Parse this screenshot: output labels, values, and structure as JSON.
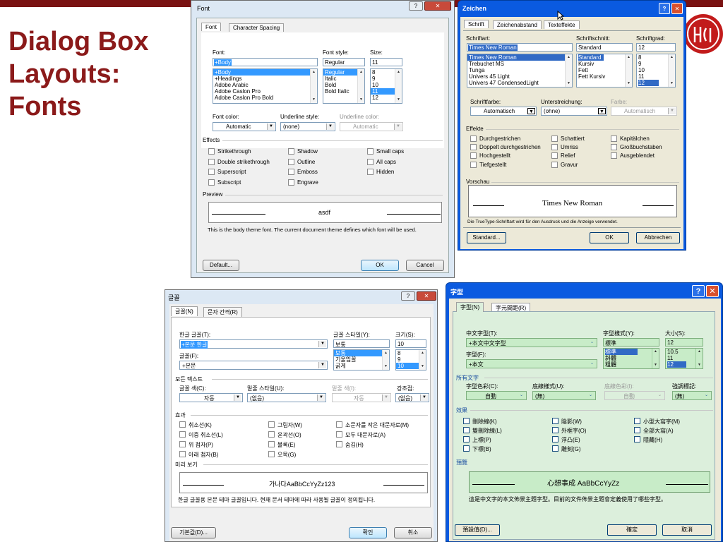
{
  "slide": {
    "title_line1": "Dialog Box",
    "title_line2": "Layouts:",
    "title_line3": "Fonts",
    "accent_color": "#8b1a1a",
    "logo_icon": "hci-logo"
  },
  "font_dialog": {
    "title": "Font",
    "help_glyph": "?",
    "close_glyph": "✕",
    "tabs": [
      "Font",
      "Character Spacing"
    ],
    "font_label": "Font:",
    "font_value": "+Body",
    "font_items": [
      "+Body",
      "+Headings",
      "Adobe Arabic",
      "Adobe Caslon Pro",
      "Adobe Caslon Pro Bold"
    ],
    "style_label": "Font style:",
    "style_value": "Regular",
    "style_items": [
      "Regular",
      "Italic",
      "Bold",
      "Bold Italic"
    ],
    "size_label": "Size:",
    "size_value": "11",
    "size_items": [
      "8",
      "9",
      "10",
      "11",
      "12"
    ],
    "color_label": "Font color:",
    "color_value": "Automatic",
    "underline_style_label": "Underline style:",
    "underline_style_value": "(none)",
    "underline_color_label": "Underline color:",
    "underline_color_value": "Automatic",
    "effects_label": "Effects",
    "effects": [
      "Strikethrough",
      "Double strikethrough",
      "Superscript",
      "Subscript",
      "Shadow",
      "Outline",
      "Emboss",
      "Engrave",
      "Small caps",
      "All caps",
      "Hidden"
    ],
    "preview_label": "Preview",
    "preview_text": "asdf",
    "description": "This is the body theme font. The current document theme defines which font will be used.",
    "default_button": "Default...",
    "ok_button": "OK",
    "cancel_button": "Cancel"
  },
  "zeichen_dialog": {
    "title": "Zeichen",
    "help_glyph": "?",
    "close_glyph": "✕",
    "tabs": [
      "Schrift",
      "Zeichenabstand",
      "Texteffekte"
    ],
    "font_label": "Schriftart:",
    "font_value": "Times New Roman",
    "font_items": [
      "Times New Roman",
      "Trebuchet MS",
      "Tunga",
      "Univers 45 Light",
      "Univers 47 CondensedLight"
    ],
    "style_label": "Schriftschnitt:",
    "style_value": "Standard",
    "style_items": [
      "Standard",
      "Kursiv",
      "Fett",
      "Fett Kursiv"
    ],
    "size_label": "Schriftgrad:",
    "size_value": "12",
    "size_items": [
      "8",
      "9",
      "10",
      "11",
      "12"
    ],
    "color_label": "Schriftfarbe:",
    "color_value": "Automatisch",
    "underline_label": "Unterstreichung:",
    "underline_value": "(ohne)",
    "underline_color_label": "Farbe:",
    "underline_color_value": "Automatisch",
    "effects_label": "Effekte",
    "effects": [
      "Durchgestrichen",
      "Doppelt durchgestrichen",
      "Hochgestellt",
      "Tiefgestellt",
      "Schattiert",
      "Umriss",
      "Relief",
      "Gravur",
      "Kapitälchen",
      "Großbuchstaben",
      "Ausgeblendet"
    ],
    "preview_label": "Vorschau",
    "preview_text": "Times New Roman",
    "description": "Die TrueType-Schriftart wird für den Ausdruck und die Anzeige verwendet.",
    "default_button": "Standard...",
    "ok_button": "OK",
    "cancel_button": "Abbrechen"
  },
  "korean_dialog": {
    "title": "글꼴",
    "help_glyph": "?",
    "close_glyph": "✕",
    "tabs": [
      "글꼴(N)",
      "문자 간격(R)"
    ],
    "hangul_font_label": "한글 글꼴(T):",
    "hangul_font_value": "+본문 한글",
    "font_label": "글꼴(F):",
    "font_value": "+본문",
    "style_label": "글꼴 스타일(Y):",
    "style_value": "보통",
    "style_items": [
      "보통",
      "기울임꼴",
      "굵게"
    ],
    "size_label": "크기(S):",
    "size_value": "10",
    "size_items": [
      "8",
      "9",
      "10"
    ],
    "all_text_label": "모든 텍스트",
    "color_label": "글꼴 색(C):",
    "color_value": "자동",
    "underline_style_label": "밑줄 스타일(U):",
    "underline_style_value": "(없음)",
    "underline_color_label": "밑줄 색(I):",
    "underline_color_value": "자동",
    "emphasis_label": "강조점:",
    "emphasis_value": "(없음)",
    "effects_label": "효과",
    "effects": [
      "취소선(K)",
      "이중 취소선(L)",
      "위 첨자(P)",
      "아래 첨자(B)",
      "그림자(W)",
      "윤곽선(O)",
      "볼록(E)",
      "오목(G)",
      "소문자를 작은 대문자로(M)",
      "모두 대문자로(A)",
      "숨김(H)"
    ],
    "preview_label": "미리 보기",
    "preview_text": "가나다AaBbCcYyZz123",
    "description": "한글 글꼴용 본문 테마 글꼴입니다. 현재 문서 테마에 따라 사용될 글꼴이 정의됩니다.",
    "default_button": "기본값(D)...",
    "ok_button": "확인",
    "cancel_button": "취소"
  },
  "chinese_dialog": {
    "title": "字型",
    "help_glyph": "?",
    "close_glyph": "✕",
    "tabs": [
      "字型(N)",
      "字元間距(R)"
    ],
    "cjk_font_label": "中文字型(T):",
    "cjk_font_value": "+本文中文字型",
    "font_label": "字型(F):",
    "font_value": "+本文",
    "style_label": "字型樣式(Y):",
    "style_value": "標準",
    "style_items": [
      "標準",
      "斜體",
      "粗體"
    ],
    "size_label": "大小(S):",
    "size_value": "12",
    "size_items": [
      "10.5",
      "11",
      "12"
    ],
    "all_text_label": "所有文字",
    "color_label": "字型色彩(C):",
    "color_value": "自動",
    "underline_style_label": "底線樣式(U):",
    "underline_style_value": "(無)",
    "underline_color_label": "底線色彩(I):",
    "underline_color_value": "自動",
    "emphasis_label": "強調標記:",
    "emphasis_value": "(無)",
    "effects_label": "效果",
    "effects": [
      "刪除線(K)",
      "雙刪除線(L)",
      "上標(P)",
      "下標(B)",
      "陰影(W)",
      "外框字(O)",
      "浮凸(E)",
      "雕刻(G)",
      "小型大寫字(M)",
      "全部大寫(A)",
      "隱藏(H)"
    ],
    "preview_label": "預覽",
    "preview_text": "心想事成 AaBbCcYyZz",
    "description": "這是中文字的本文佈景主題字型。目前的文件佈景主題會定義使用了哪些字型。",
    "default_button": "預設值(D)...",
    "ok_button": "確定",
    "cancel_button": "取消"
  }
}
